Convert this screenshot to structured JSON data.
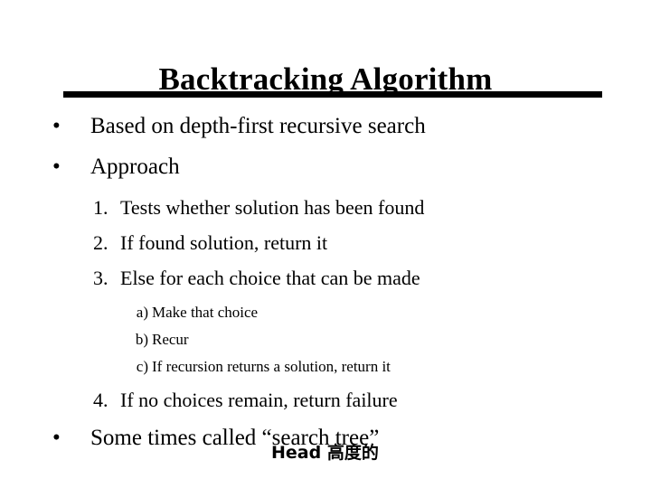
{
  "slide": {
    "title": "Backtracking Algorithm",
    "rule_color": "#000000",
    "background_color": "#ffffff",
    "text_color": "#000000"
  },
  "bullets": {
    "bullet_glyph": "•",
    "level1": [
      {
        "text": "Based on depth-first recursive search"
      },
      {
        "text": "Approach"
      }
    ],
    "level1_last": {
      "text": "Some times called “search tree”"
    }
  },
  "numbered": [
    {
      "marker": "1.",
      "text": "Tests whether solution has been found"
    },
    {
      "marker": "2.",
      "text": "If found solution, return it"
    },
    {
      "marker": "3.",
      "text": "Else for each choice that can be made"
    }
  ],
  "lettered": [
    {
      "marker": "a)",
      "text": "Make that choice"
    },
    {
      "marker": "b)",
      "text": "Recur"
    },
    {
      "marker": "c)",
      "text": "If recursion returns a solution, return it"
    }
  ],
  "numbered_last": {
    "marker": "4.",
    "text": "If no choices remain, return failure"
  },
  "overlay": {
    "text": "Head 高度的"
  }
}
